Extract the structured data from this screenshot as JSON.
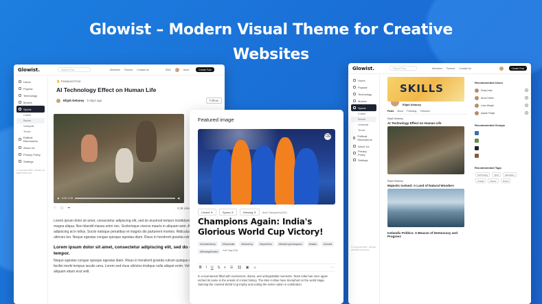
{
  "hero": {
    "line1": "Glowist – Modern Visual Theme for Creative",
    "line2": "Websites"
  },
  "colors": {
    "background": "#1b6fd6",
    "dark": "#1d2330",
    "accent": "#1f58c9"
  },
  "left_window": {
    "logo": "Glowist.",
    "search_placeholder": "Search Post",
    "nav": [
      "Members",
      "Forums",
      "Contact Us"
    ],
    "lang": "ENG",
    "user": "Anna",
    "create_button": "Create Post",
    "sidebar": [
      {
        "label": "Home",
        "icon": "home-icon"
      },
      {
        "label": "Popular",
        "icon": "trend-icon"
      },
      {
        "label": "Technology",
        "icon": "chip-icon"
      },
      {
        "label": "Movies",
        "icon": "film-icon"
      },
      {
        "label": "Sports",
        "icon": "ball-icon"
      }
    ],
    "sidebar_sub": [
      "Cricket",
      "Soccer",
      "Volleyball",
      "Tennis"
    ],
    "sidebar_more": [
      {
        "label": "Political Discussions",
        "icon": "flag-icon"
      },
      {
        "label": "About Us",
        "icon": "info-icon"
      },
      {
        "label": "Privacy Policy",
        "icon": "lock-icon"
      },
      {
        "label": "Settings",
        "icon": "gear-icon"
      }
    ],
    "copyright": "© Copyright 2025 · Glowist. All Rights Reserved",
    "featured_label": "Featured Post",
    "title": "AI Technology Effect on Human Life",
    "author": "Elijah Delaney",
    "time": "5 days ago",
    "follow": "Follow",
    "video_time": "0:18 / 0:25",
    "likes": "2.1k Like",
    "comments": "896 Comment",
    "para1": "Lorem ipsum dolor sit amet, consectetur adipiscing elit, sed do eiusmod tempor incididunt ut labore et dolore magna aliqua. Non blandit massa enim nec. Scelerisque viverra mauris in aliquam sem. At risus viverra adipiscing at in tellus. Sociis natoque penatibus et magnis dis parturient montes. Ridiculus mus mauris vitae ultricies leo. Neque egestas congue quisque egestas diam. Risus in hendrerit gravida rutrum quisque non.",
    "heading2": "Lorem ipsum dolor sit amet, consectetur adipiscing elit, sed do eiusmod tempor.",
    "para2": "Neque egestas congue quisque egestas diam. Risus in hendrerit gravida rutrum quisque non. Sit amet nulla facilisi morbi tempus iaculis urna. Lorem sed risus ultricies tristique nulla aliquet enim. Volutpat blandit aliquam etiam erat velit."
  },
  "modal": {
    "heading": "Featured image",
    "categories": [
      "Cricket",
      "Sports",
      "Winning"
    ],
    "add_categories": "Add Categories(3/3)",
    "title": "Champions Again: India's Glorious World Cup Victory!",
    "hashtags": [
      "#CricketVictory",
      "#TeamIndia",
      "#WorldCup",
      "#SportsFan",
      "#WorldCupChampions",
      "#Indian",
      "#Cricket",
      "#WinningMoment"
    ],
    "add_tags": "Add Tags (0/5)",
    "body": "In a tournament filled with excitement, drama, and unforgettable moments, Team India has once again etched its name in the annals of cricket history. The Men in Blue have triumphed on the world stage, claiming the coveted World Cup trophy and uniting the entire nation in celebration."
  },
  "right_window": {
    "logo": "Glowist.",
    "banner_text": "SKILLS",
    "profile_name": "Elijah Delaney",
    "tabs": [
      "Posts",
      "About",
      "Following",
      "Followers"
    ],
    "post1_author": "Elijah Delaney",
    "post1_title": "AI Technology Effect on Human Life",
    "post2_author": "Elijah Delaney",
    "post2_title": "Majestic Iceland: A Land of Natural Wonders",
    "post3_title": "Icelandic Politics: A Beacon of Democracy and Progress",
    "side_heading1": "Recommended Users",
    "users": [
      "Ruby Hale",
      "Anna Harris",
      "Liam Wright",
      "Ayaan Rojas"
    ],
    "side_heading2": "Recommended Groups",
    "side_heading3": "Recommended Tags",
    "tags": [
      "Technology",
      "Sport",
      "Education",
      "Cricket",
      "Soccer",
      "Tennis"
    ],
    "copyright": "© Copyright 2025 · Glowist. All Rights Reserved"
  }
}
